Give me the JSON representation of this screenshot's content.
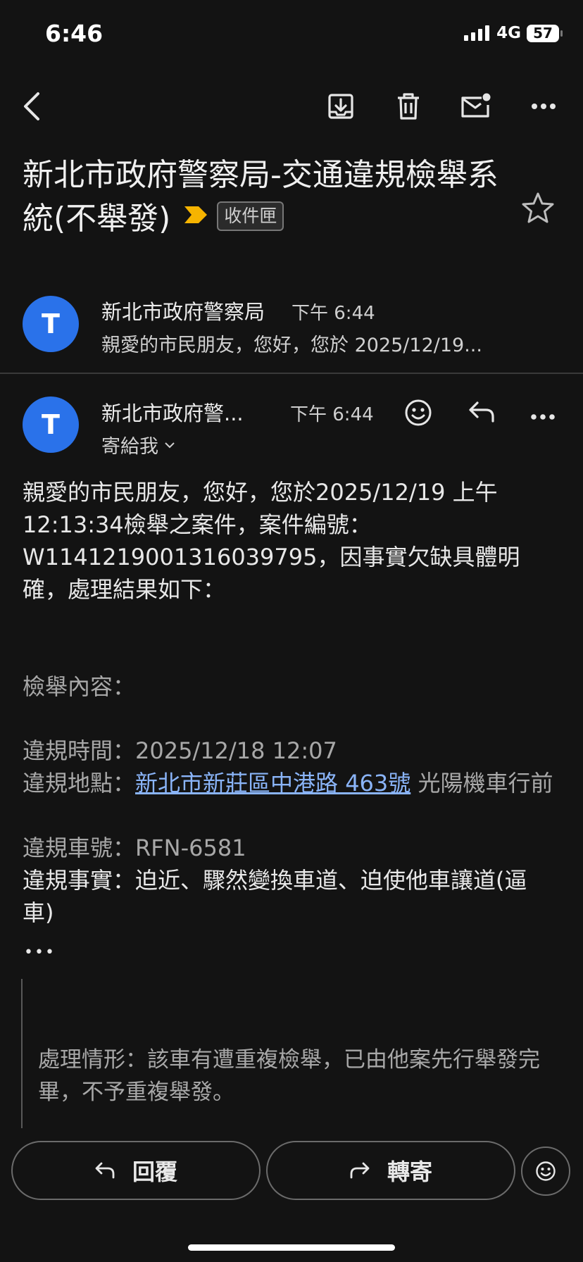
{
  "status_bar": {
    "time": "6:46",
    "network": "4G",
    "battery": "57"
  },
  "subject": {
    "title": "新北市政府警察局-交通違規檢舉系統(不舉發)",
    "label": "收件匣"
  },
  "thread_item": {
    "avatar": "T",
    "sender": "新北市政府警察局",
    "time": "下午 6:44",
    "snippet": "親愛的市民朋友，您好，您於 2025/12/19..."
  },
  "message": {
    "avatar": "T",
    "sender": "新北市政府警...",
    "time": "下午 6:44",
    "recipient": "寄給我",
    "intro": "親愛的市民朋友，您好，您於2025/12/19 上午12:13:34檢舉之案件，案件編號：W1141219001316039795，因事實欠缺具體明確，處理結果如下：",
    "content_heading": "檢舉內容：",
    "time_label": "違規時間：",
    "time_value": "2025/12/18 12:07",
    "location_label": "違規地點：",
    "location_link": "新北市新莊區中港路 463號",
    "location_rest": " 光陽機車行前",
    "plate_label": "違規車號：",
    "plate_value": "RFN-6581",
    "fact_label": "違規事實：",
    "fact_value": "迫近、驟然變換車道、迫使他車讓道(逼車)",
    "ellipsis": "•••",
    "quoted": "處理情形：該車有遭重複檢舉，已由他案先行舉發完畢，不予重複舉發。"
  },
  "actions": {
    "reply": "回覆",
    "forward": "轉寄"
  },
  "icons": {
    "back": "chevron-left-icon",
    "archive": "archive-icon",
    "delete": "trash-icon",
    "unread": "mark-unread-icon",
    "more": "more-horizontal-icon",
    "star": "star-icon",
    "important": "important-marker-icon",
    "emoji": "smiley-icon",
    "reply": "reply-icon",
    "forward": "forward-icon"
  },
  "colors": {
    "background": "#131313",
    "avatar": "#2a72ea",
    "link": "#8ab4f8",
    "important": "#f6b400"
  }
}
